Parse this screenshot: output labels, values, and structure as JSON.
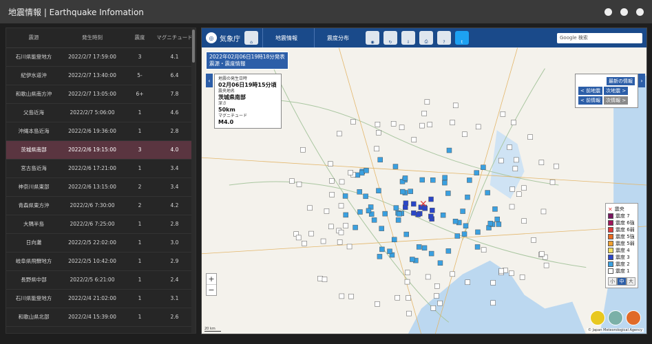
{
  "app": {
    "title": "地震情報 | Earthquake Infomation"
  },
  "table": {
    "headers": [
      "震源",
      "発生時刻",
      "震度",
      "マグニチュード"
    ],
    "rows": [
      [
        "石川県能登地方",
        "2022/2/7 17:59:00",
        "3",
        "4.1"
      ],
      [
        "紀伊水道沖",
        "2022/2/7 13:40:00",
        "5-",
        "6.4"
      ],
      [
        "和歌山県南方沖",
        "2022/2/7 13:05:00",
        "6+",
        "7.8"
      ],
      [
        "父島近海",
        "2022/2/7 5:06:00",
        "1",
        "4.6"
      ],
      [
        "沖縄本島近海",
        "2022/2/6 19:36:00",
        "1",
        "2.8"
      ],
      [
        "茨城県南部",
        "2022/2/6 19:15:00",
        "3",
        "4.0"
      ],
      [
        "宮古島近海",
        "2022/2/6 17:21:00",
        "1",
        "3.4"
      ],
      [
        "神奈川県東部",
        "2022/2/6 13:15:00",
        "2",
        "3.4"
      ],
      [
        "青森県東方沖",
        "2022/2/6 7:30:00",
        "2",
        "4.2"
      ],
      [
        "大隅半島",
        "2022/2/6 7:25:00",
        "1",
        "2.8"
      ],
      [
        "日向灘",
        "2022/2/5 22:02:00",
        "1",
        "3.0"
      ],
      [
        "岐阜県飛騨地方",
        "2022/2/5 10:42:00",
        "1",
        "2.9"
      ],
      [
        "長野県中部",
        "2022/2/5 6:21:00",
        "1",
        "2.4"
      ],
      [
        "石川県能登地方",
        "2022/2/4 21:02:00",
        "1",
        "3.1"
      ],
      [
        "和歌山県北部",
        "2022/2/4 15:39:00",
        "1",
        "2.6"
      ]
    ],
    "selected_index": 5
  },
  "jma": {
    "logo": "気象庁",
    "menu_quake": "地震情報",
    "menu_dist": "震度分布",
    "search_placeholder": "Google 検索",
    "banner_line1": "2022年02月06日19時18分発表",
    "banner_line2": "震源・震度情報",
    "info_label_time": "地震の発生日時",
    "info_time": "02月06日19時15分頃",
    "info_label_place": "震央地名",
    "info_place": "茨城県南部",
    "info_label_depth": "深さ",
    "info_depth": "50km",
    "info_label_mag": "マグニチュード",
    "info_mag": "M4.0",
    "nav_latest": "最新の情報",
    "nav_prev_quake": "< 前地震",
    "nav_next_quake": "次地震 >",
    "nav_prev_info": "< 前情報",
    "nav_next_info": "次情報 >",
    "legend_title": "震央",
    "legend": [
      {
        "label": "震度 7",
        "color": "#7a1560"
      },
      {
        "label": "震度 6強",
        "color": "#a0145a"
      },
      {
        "label": "震度 6弱",
        "color": "#e03b3b"
      },
      {
        "label": "震度 5強",
        "color": "#e86a20"
      },
      {
        "label": "震度 5弱",
        "color": "#f0a030"
      },
      {
        "label": "震度 4",
        "color": "#f3e060"
      },
      {
        "label": "震度 3",
        "color": "#2a46c8"
      },
      {
        "label": "震度 2",
        "color": "#3aa0e0"
      },
      {
        "label": "震度 1",
        "color": "#ffffff"
      }
    ],
    "size_small": "小",
    "size_mid": "中",
    "size_large": "大",
    "credit": "© Japan Meteorological Agency",
    "scale": "20 km"
  }
}
